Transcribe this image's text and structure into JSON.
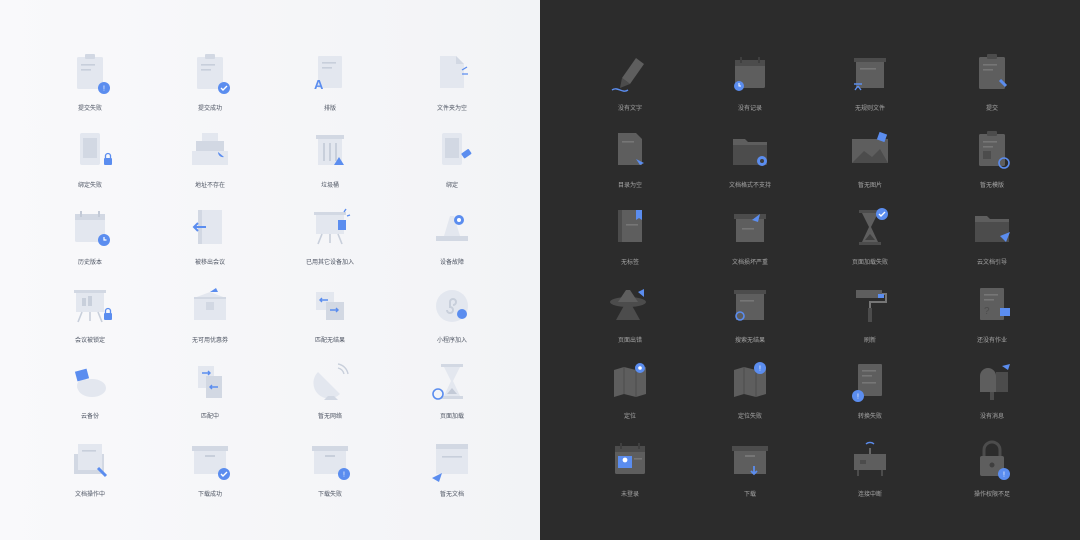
{
  "colors": {
    "light_bg": "#f4f5f8",
    "dark_bg": "#2c2c2c",
    "accent": "#5b8def",
    "light_icon": "#e4e8f0",
    "dark_icon": "#5f5f5f"
  },
  "light_panel": {
    "items": [
      {
        "label": "提交失败",
        "icon": "clipboard-error-icon"
      },
      {
        "label": "提交成功",
        "icon": "clipboard-success-icon"
      },
      {
        "label": "排版",
        "icon": "typesetting-icon"
      },
      {
        "label": "文件夹为空",
        "icon": "empty-folder-icon"
      },
      {
        "label": "绑定失败",
        "icon": "bind-fail-icon"
      },
      {
        "label": "地址不存在",
        "icon": "address-missing-icon"
      },
      {
        "label": "垃圾桶",
        "icon": "trash-icon"
      },
      {
        "label": "绑定",
        "icon": "bind-icon"
      },
      {
        "label": "历史版本",
        "icon": "history-version-icon"
      },
      {
        "label": "被移出会议",
        "icon": "removed-meeting-icon"
      },
      {
        "label": "已用其它设备加入",
        "icon": "other-device-joined-icon"
      },
      {
        "label": "设备故障",
        "icon": "device-fault-icon"
      },
      {
        "label": "会议被锁定",
        "icon": "meeting-locked-icon"
      },
      {
        "label": "无可用优惠券",
        "icon": "no-coupon-icon"
      },
      {
        "label": "匹配无结果",
        "icon": "match-no-result-icon"
      },
      {
        "label": "小程序加入",
        "icon": "mini-program-join-icon"
      },
      {
        "label": "云备份",
        "icon": "cloud-backup-icon"
      },
      {
        "label": "匹配中",
        "icon": "matching-icon"
      },
      {
        "label": "暂无网络",
        "icon": "no-network-icon"
      },
      {
        "label": "页面加载",
        "icon": "page-loading-icon"
      },
      {
        "label": "文档操作中",
        "icon": "doc-operating-icon"
      },
      {
        "label": "下载成功",
        "icon": "download-success-icon"
      },
      {
        "label": "下载失败",
        "icon": "download-fail-icon"
      },
      {
        "label": "暂无文档",
        "icon": "no-document-icon"
      }
    ]
  },
  "dark_panel": {
    "items": [
      {
        "label": "没有文字",
        "icon": "no-text-pen-icon"
      },
      {
        "label": "没有记录",
        "icon": "no-record-icon"
      },
      {
        "label": "无规则文件",
        "icon": "no-rule-file-icon"
      },
      {
        "label": "提交",
        "icon": "submit-icon"
      },
      {
        "label": "目录为空",
        "icon": "empty-directory-icon"
      },
      {
        "label": "文档格式不支持",
        "icon": "unsupported-format-icon"
      },
      {
        "label": "暂无图片",
        "icon": "no-image-icon"
      },
      {
        "label": "暂无模版",
        "icon": "no-template-icon"
      },
      {
        "label": "无标签",
        "icon": "no-tag-icon"
      },
      {
        "label": "文档损坏严重",
        "icon": "doc-damaged-icon"
      },
      {
        "label": "页面加载失败",
        "icon": "page-load-fail-icon"
      },
      {
        "label": "云文档引导",
        "icon": "cloud-doc-guide-icon"
      },
      {
        "label": "页面出错",
        "icon": "page-error-icon"
      },
      {
        "label": "搜索无结果",
        "icon": "search-no-result-icon"
      },
      {
        "label": "刷新",
        "icon": "refresh-roller-icon"
      },
      {
        "label": "还没有作业",
        "icon": "no-homework-icon"
      },
      {
        "label": "定位",
        "icon": "location-icon"
      },
      {
        "label": "定位失败",
        "icon": "location-fail-icon"
      },
      {
        "label": "转换失败",
        "icon": "convert-fail-icon"
      },
      {
        "label": "没有消息",
        "icon": "no-message-mailbox-icon"
      },
      {
        "label": "未登录",
        "icon": "not-logged-in-icon"
      },
      {
        "label": "下载",
        "icon": "download-icon"
      },
      {
        "label": "连接中断",
        "icon": "connection-lost-icon"
      },
      {
        "label": "操作权限不足",
        "icon": "no-permission-icon"
      }
    ]
  }
}
